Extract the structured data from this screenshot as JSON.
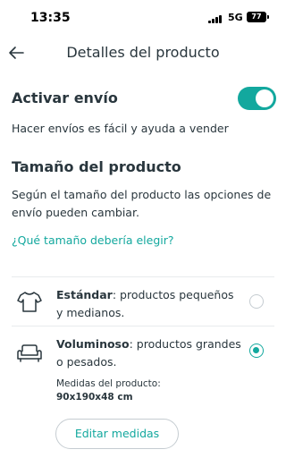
{
  "status_bar": {
    "time": "13:35",
    "network": "5G",
    "battery": "77"
  },
  "header": {
    "title": "Detalles del producto",
    "back_icon": "arrow-left-icon"
  },
  "shipping": {
    "title": "Activar envío",
    "enabled": true,
    "subtitle": "Hacer envíos es fácil y ayuda a vender"
  },
  "size": {
    "title": "Tamaño del producto",
    "description": "Según el tamaño del producto las opciones de envío pueden cambiar.",
    "help_link": "¿Qué tamaño debería elegir?"
  },
  "options": [
    {
      "icon": "tshirt-icon",
      "name": "Estándar",
      "description": ": productos pequeños y medianos.",
      "selected": false
    },
    {
      "icon": "sofa-icon",
      "name": "Voluminoso",
      "description": ": productos grandes o pesados.",
      "selected": true
    }
  ],
  "measures": {
    "label": "Medidas del producto:",
    "value": "90x190x48 cm",
    "edit_label": "Editar medidas"
  },
  "colors": {
    "accent": "#13a89e",
    "text": "#29363d",
    "divider": "#e8ebed"
  }
}
